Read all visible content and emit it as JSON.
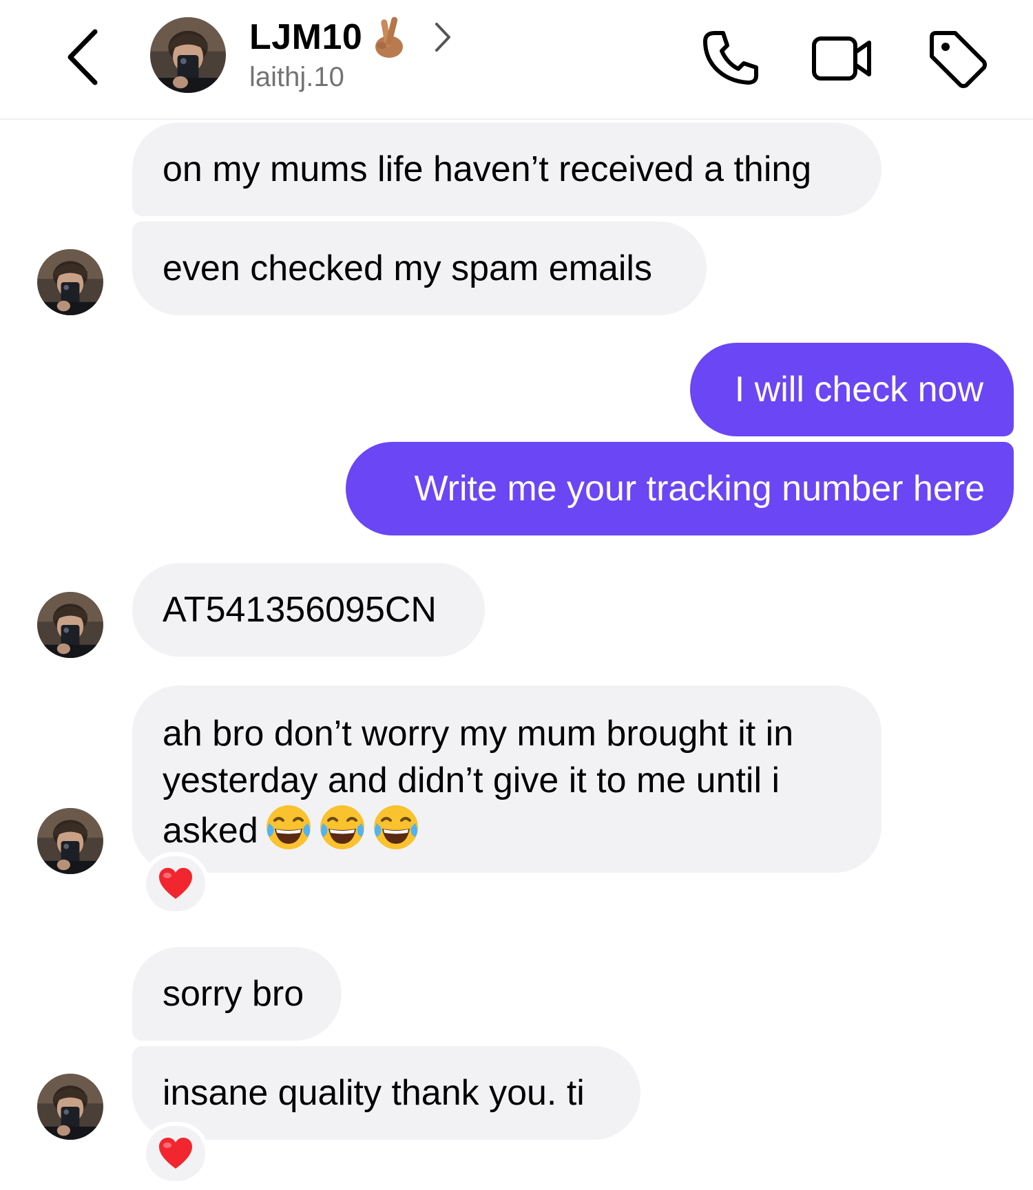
{
  "header": {
    "contact_name": "LJM10",
    "contact_emoji": "crossed-fingers-emoji",
    "username": "laithj.10",
    "icons": [
      "back-chevron-icon",
      "phone-icon",
      "video-camera-icon",
      "tag-icon",
      "chevron-right-icon"
    ]
  },
  "colors": {
    "outgoing_bubble": "#6a46f5",
    "incoming_bubble": "#f2f2f5",
    "secondary_text": "#737373"
  },
  "messages": [
    {
      "from": "contact",
      "text": "on my mums life haven’t received a thing"
    },
    {
      "from": "contact",
      "text": "even checked my spam emails"
    },
    {
      "from": "me",
      "text": "I will check now"
    },
    {
      "from": "me",
      "text": "Write me your tracking number here"
    },
    {
      "from": "contact",
      "text": "AT541356095CN"
    },
    {
      "from": "contact",
      "line1": "ah bro don’t worry my mum brought it in",
      "line2": "yesterday and didn’t give it to me until i",
      "line3": "asked",
      "emojis": [
        "tears-of-joy-emoji",
        "tears-of-joy-emoji",
        "tears-of-joy-emoji"
      ],
      "reaction": "red-heart-emoji"
    },
    {
      "from": "contact",
      "text": "sorry bro"
    },
    {
      "from": "contact",
      "text": "insane quality thank you. ti",
      "reaction": "red-heart-emoji"
    }
  ]
}
